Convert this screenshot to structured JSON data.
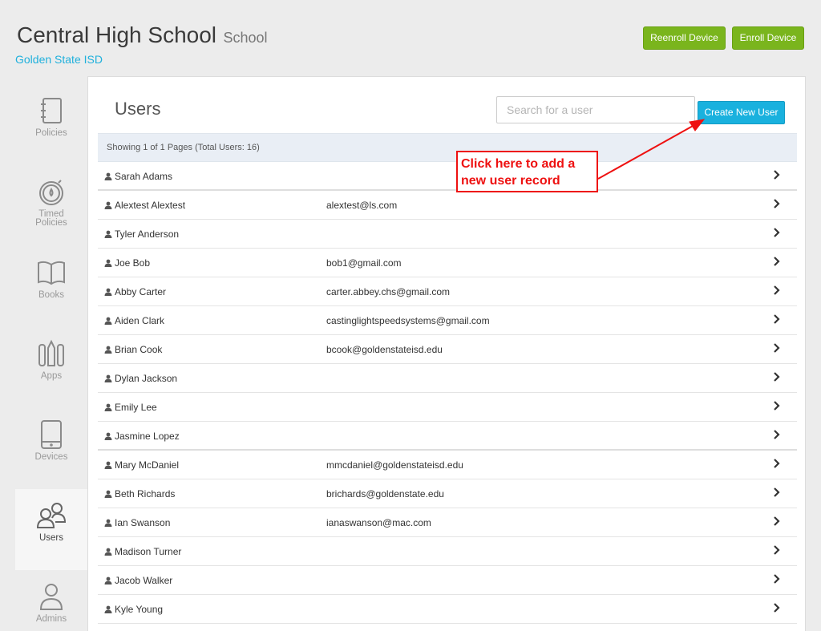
{
  "header": {
    "school_name": "Central High School",
    "school_type": "School",
    "district": "Golden State ISD",
    "reenroll_label": "Reenroll Device",
    "enroll_label": "Enroll Device"
  },
  "sidebar": {
    "items": [
      {
        "label": "Policies",
        "icon": "notebook-icon"
      },
      {
        "label": "Timed Policies",
        "icon": "timer-icon"
      },
      {
        "label": "Books",
        "icon": "book-icon"
      },
      {
        "label": "Apps",
        "icon": "apps-icon"
      },
      {
        "label": "Devices",
        "icon": "tablet-icon"
      },
      {
        "label": "Users",
        "icon": "users-icon",
        "active": true
      },
      {
        "label": "Admins",
        "icon": "admin-icon"
      }
    ]
  },
  "main": {
    "title": "Users",
    "search_placeholder": "Search for a user",
    "create_label": "Create New User",
    "status": "Showing 1 of 1 Pages (Total Users: 16)",
    "users": [
      {
        "name": "Sarah Adams",
        "email": ""
      },
      {
        "name": "Alextest Alextest",
        "email": "alextest@ls.com"
      },
      {
        "name": "Tyler Anderson",
        "email": ""
      },
      {
        "name": "Joe Bob",
        "email": "bob1@gmail.com"
      },
      {
        "name": "Abby Carter",
        "email": "carter.abbey.chs@gmail.com"
      },
      {
        "name": "Aiden Clark",
        "email": "castinglightspeedsystems@gmail.com"
      },
      {
        "name": "Brian Cook",
        "email": "bcook@goldenstateisd.edu"
      },
      {
        "name": "Dylan Jackson",
        "email": ""
      },
      {
        "name": "Emily Lee",
        "email": ""
      },
      {
        "name": "Jasmine Lopez",
        "email": ""
      },
      {
        "name": "Mary McDaniel",
        "email": "mmcdaniel@goldenstateisd.edu"
      },
      {
        "name": "Beth Richards",
        "email": "brichards@goldenstate.edu"
      },
      {
        "name": "Ian Swanson",
        "email": "ianaswanson@mac.com"
      },
      {
        "name": "Madison Turner",
        "email": ""
      },
      {
        "name": "Jacob Walker",
        "email": ""
      },
      {
        "name": "Kyle Young",
        "email": ""
      }
    ]
  },
  "annotation": {
    "line1": "Click here to add a",
    "line2": "new user record",
    "color": "#ee1111"
  },
  "colors": {
    "accent_green": "#7ab51d",
    "accent_blue": "#19b1de",
    "link_blue": "#1fb0dc"
  }
}
